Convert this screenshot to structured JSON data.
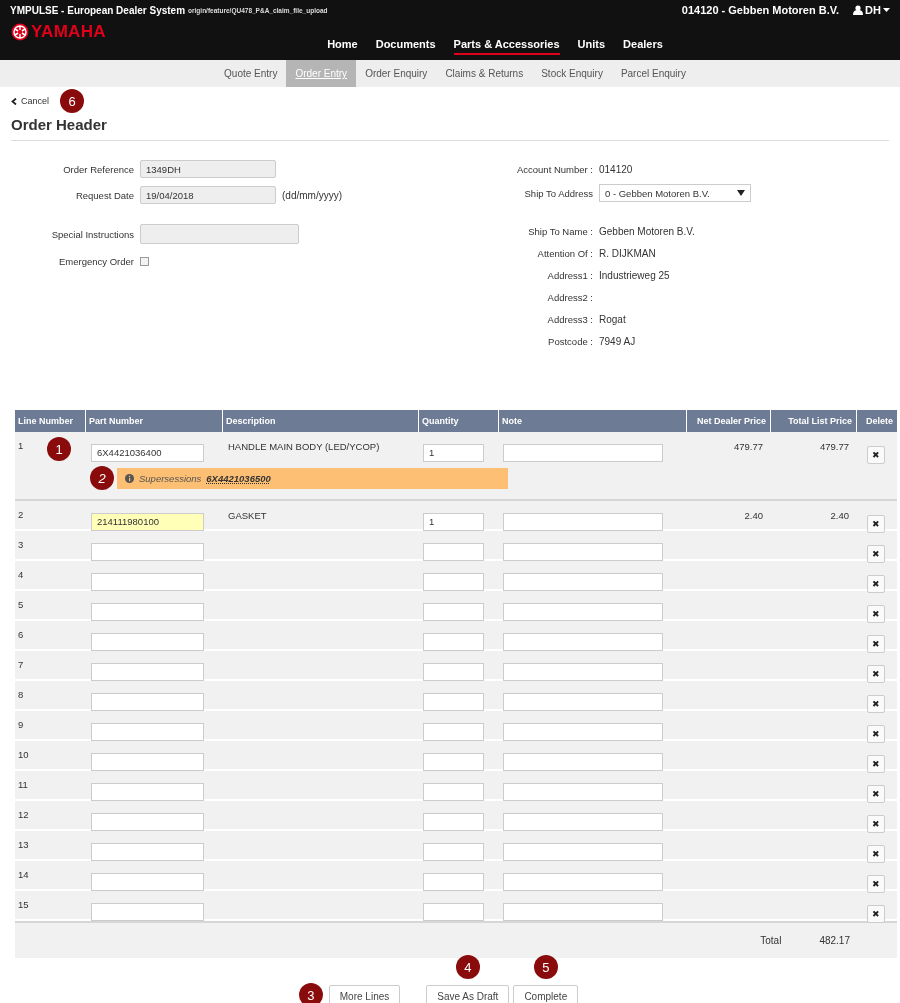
{
  "header": {
    "title": "YMPULSE - European Dealer System",
    "branch": "origin/feature/QU478_P&A_claim_file_upload",
    "account": "014120 - Gebben Motoren B.V.",
    "user": "DH",
    "logo": "YAMAHA"
  },
  "nav": [
    {
      "label": "Home",
      "selected": false
    },
    {
      "label": "Documents",
      "selected": false
    },
    {
      "label": "Parts & Accessories",
      "selected": true
    },
    {
      "label": "Units",
      "selected": false
    },
    {
      "label": "Dealers",
      "selected": false
    }
  ],
  "subnav": [
    {
      "label": "Quote Entry",
      "selected": false
    },
    {
      "label": "Order Entry",
      "selected": true
    },
    {
      "label": "Order Enquiry",
      "selected": false
    },
    {
      "label": "Claims & Returns",
      "selected": false
    },
    {
      "label": "Stock Enquiry",
      "selected": false
    },
    {
      "label": "Parcel Enquiry",
      "selected": false
    }
  ],
  "cancel": {
    "label": "Cancel",
    "callout": "6"
  },
  "page_title": "Order Header",
  "left_groups": [
    [
      {
        "kind": "input",
        "label": "Order Reference",
        "value": "1349DH"
      },
      {
        "kind": "input",
        "label": "Request Date",
        "value": "19/04/2018",
        "hint": "(dd/mm/yyyy)"
      }
    ],
    [
      {
        "kind": "wide-input",
        "label": "Special Instructions"
      },
      {
        "kind": "checkbox",
        "label": "Emergency Order",
        "checked": false
      }
    ]
  ],
  "right_groups": [
    [
      {
        "kind": "text",
        "label": "Account Number :",
        "value": "014120"
      },
      {
        "kind": "select",
        "label": "Ship To Address",
        "value": "0 - Gebben Motoren B.V."
      }
    ],
    [
      {
        "kind": "text",
        "label": "Ship To Name :",
        "value": "Gebben Motoren B.V."
      },
      {
        "kind": "text",
        "label": "Attention Of :",
        "value": "R. DIJKMAN"
      },
      {
        "kind": "text",
        "label": "Address1 :",
        "value": "Industrieweg 25"
      },
      {
        "kind": "text",
        "label": "Address2 :"
      },
      {
        "kind": "text",
        "label": "Address3 :",
        "value": "Rogat"
      },
      {
        "kind": "text",
        "label": "Postcode :",
        "value": "7949 AJ"
      }
    ]
  ],
  "table": {
    "columns": [
      "Line Number",
      "Part Number",
      "Description",
      "Quantity",
      "Note",
      "Net Dealer Price",
      "Total List Price",
      "Delete"
    ],
    "rows": [
      {
        "line": "1",
        "part_number": "6X4421036400",
        "highlighted": false,
        "description": "HANDLE MAIN BODY (LED/YCOP)",
        "quantity": "1",
        "net_price": "479.77",
        "total_price": "479.77",
        "callout": "1",
        "notice": {
          "text": "Supersessions",
          "link": "6X4421036500",
          "callout": "2"
        }
      },
      {
        "line": "2",
        "part_number": "214111980100",
        "highlighted": true,
        "description": "GASKET",
        "quantity": "1",
        "net_price": "2.40",
        "total_price": "2.40"
      },
      {
        "line": "3",
        "highlighted": false
      },
      {
        "line": "4",
        "highlighted": false
      },
      {
        "line": "5",
        "highlighted": false
      },
      {
        "line": "6",
        "highlighted": false
      },
      {
        "line": "7",
        "highlighted": false
      },
      {
        "line": "8",
        "highlighted": false
      },
      {
        "line": "9",
        "highlighted": false
      },
      {
        "line": "10",
        "highlighted": false
      },
      {
        "line": "11",
        "highlighted": false
      },
      {
        "line": "12",
        "highlighted": false
      },
      {
        "line": "13",
        "highlighted": false
      },
      {
        "line": "14",
        "highlighted": false
      },
      {
        "line": "15",
        "highlighted": false
      }
    ],
    "delete_glyph": "✖",
    "total_label": "Total",
    "total": "482.17"
  },
  "buttons": [
    {
      "label": "More Lines",
      "callout": "3"
    },
    {
      "label": "Save As Draft",
      "callout": "4"
    },
    {
      "label": "Complete",
      "callout": "5"
    }
  ]
}
